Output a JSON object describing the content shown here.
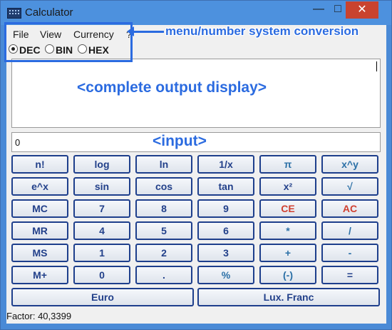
{
  "window": {
    "title": "Calculator",
    "minimize_glyph": "—",
    "maximize_glyph": "□",
    "close_glyph": "✕"
  },
  "menu": [
    "File",
    "View",
    "Currency",
    "?"
  ],
  "number_system": {
    "options": [
      "DEC",
      "BIN",
      "HEX"
    ],
    "selected": "DEC"
  },
  "display": {
    "output": "",
    "input": "0"
  },
  "keys": [
    [
      "n!",
      "log",
      "ln",
      "1/x",
      "π",
      "x^y"
    ],
    [
      "e^x",
      "sin",
      "cos",
      "tan",
      "x²",
      "√"
    ],
    [
      "MC",
      "7",
      "8",
      "9",
      "CE",
      "AC"
    ],
    [
      "MR",
      "4",
      "5",
      "6",
      "*",
      "/"
    ],
    [
      "MS",
      "1",
      "2",
      "3",
      "+",
      "-"
    ],
    [
      "M+",
      "0",
      ".",
      "%",
      "(-)",
      "="
    ]
  ],
  "currency_buttons": [
    "Euro",
    "Lux. Franc"
  ],
  "status": "Factor: 40,3399",
  "annotations": {
    "menu": "menu/number system conversion",
    "output": "<complete output display>",
    "input": "<input>"
  },
  "colors": {
    "annotation": "#2b6be0",
    "key_border": "#1e3f8c",
    "key_text": "#22408a",
    "red_key": "#d04030"
  }
}
